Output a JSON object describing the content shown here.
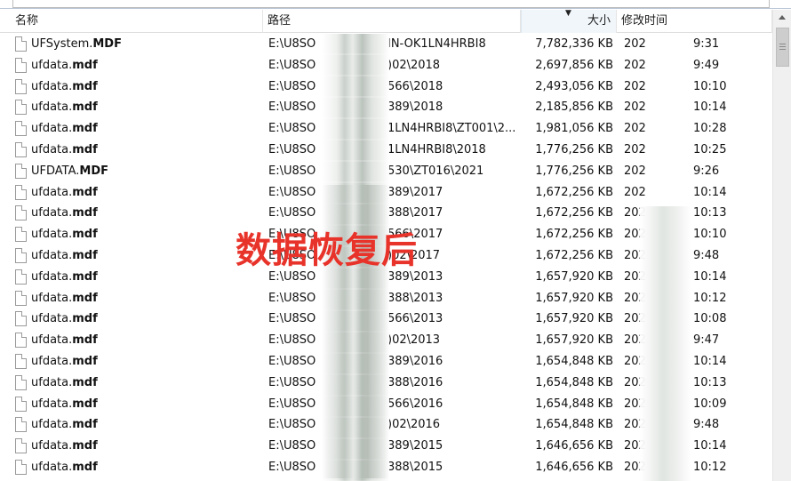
{
  "header": {
    "name": "名称",
    "path": "路径",
    "size": "大小",
    "date": "修改时间"
  },
  "watermark": "数据恢复后",
  "rows": [
    {
      "name_prefix": "UFSystem.",
      "name_ext": "MDF",
      "path_start": "E:\\U8SO",
      "path_end": "IN-OK1LN4HRBI8",
      "size": "7,782,336 KB",
      "date_start": "202",
      "time": "9:31"
    },
    {
      "name_prefix": "ufdata.",
      "name_ext": "mdf",
      "path_start": "E:\\U8SO",
      "path_end": ")02\\2018",
      "size": "2,697,856 KB",
      "date_start": "202",
      "time": "9:49"
    },
    {
      "name_prefix": "ufdata.",
      "name_ext": "mdf",
      "path_start": "E:\\U8SO",
      "path_end": "566\\2018",
      "size": "2,493,056 KB",
      "date_start": "202",
      "time": "10:10"
    },
    {
      "name_prefix": "ufdata.",
      "name_ext": "mdf",
      "path_start": "E:\\U8SO",
      "path_end": "389\\2018",
      "size": "2,185,856 KB",
      "date_start": "202",
      "time": "10:14"
    },
    {
      "name_prefix": "ufdata.",
      "name_ext": "mdf",
      "path_start": "E:\\U8SO",
      "path_end": "1LN4HRBI8\\ZT001\\2...",
      "size": "1,981,056 KB",
      "date_start": "202",
      "time": "10:28"
    },
    {
      "name_prefix": "ufdata.",
      "name_ext": "mdf",
      "path_start": "E:\\U8SO",
      "path_end": "1LN4HRBI8\\2018",
      "size": "1,776,256 KB",
      "date_start": "202",
      "time": "10:25"
    },
    {
      "name_prefix": "UFDATA.",
      "name_ext": "MDF",
      "path_start": "E:\\U8SO",
      "path_end": "530\\ZT016\\2021",
      "size": "1,776,256 KB",
      "date_start": "202",
      "time": "9:26"
    },
    {
      "name_prefix": "ufdata.",
      "name_ext": "mdf",
      "path_start": "E:\\U8SO",
      "path_end": "389\\2017",
      "size": "1,672,256 KB",
      "date_start": "202",
      "time": "10:14"
    },
    {
      "name_prefix": "ufdata.",
      "name_ext": "mdf",
      "path_start": "E:\\U8SO",
      "path_end": "388\\2017",
      "size": "1,672,256 KB",
      "date_start": "202",
      "time": "10:13"
    },
    {
      "name_prefix": "ufdata.",
      "name_ext": "mdf",
      "path_start": "E:\\U8SO",
      "path_end": "566\\2017",
      "size": "1,672,256 KB",
      "date_start": "202",
      "time": "10:10"
    },
    {
      "name_prefix": "ufdata.",
      "name_ext": "mdf",
      "path_start": "E:\\U8SO",
      "path_end": ")02\\2017",
      "size": "1,672,256 KB",
      "date_start": "202",
      "time": "9:48"
    },
    {
      "name_prefix": "ufdata.",
      "name_ext": "mdf",
      "path_start": "E:\\U8SO",
      "path_end": "389\\2013",
      "size": "1,657,920 KB",
      "date_start": "202",
      "time": "10:14"
    },
    {
      "name_prefix": "ufdata.",
      "name_ext": "mdf",
      "path_start": "E:\\U8SO",
      "path_end": "388\\2013",
      "size": "1,657,920 KB",
      "date_start": "202",
      "time": "10:12"
    },
    {
      "name_prefix": "ufdata.",
      "name_ext": "mdf",
      "path_start": "E:\\U8SO",
      "path_end": "566\\2013",
      "size": "1,657,920 KB",
      "date_start": "202",
      "time": "10:08"
    },
    {
      "name_prefix": "ufdata.",
      "name_ext": "mdf",
      "path_start": "E:\\U8SO",
      "path_end": ")02\\2013",
      "size": "1,657,920 KB",
      "date_start": "202",
      "time": "9:47"
    },
    {
      "name_prefix": "ufdata.",
      "name_ext": "mdf",
      "path_start": "E:\\U8SO",
      "path_end": "389\\2016",
      "size": "1,654,848 KB",
      "date_start": "202",
      "time": "10:14"
    },
    {
      "name_prefix": "ufdata.",
      "name_ext": "mdf",
      "path_start": "E:\\U8SO",
      "path_end": "388\\2016",
      "size": "1,654,848 KB",
      "date_start": "202",
      "time": "10:13"
    },
    {
      "name_prefix": "ufdata.",
      "name_ext": "mdf",
      "path_start": "E:\\U8SO",
      "path_end": "566\\2016",
      "size": "1,654,848 KB",
      "date_start": "202",
      "time": "10:09"
    },
    {
      "name_prefix": "ufdata.",
      "name_ext": "mdf",
      "path_start": "E:\\U8SO",
      "path_end": ")02\\2016",
      "size": "1,654,848 KB",
      "date_start": "202",
      "time": "9:48"
    },
    {
      "name_prefix": "ufdata.",
      "name_ext": "mdf",
      "path_start": "E:\\U8SO",
      "path_end": "389\\2015",
      "size": "1,646,656 KB",
      "date_start": "202",
      "time": "10:14"
    },
    {
      "name_prefix": "ufdata.",
      "name_ext": "mdf",
      "path_start": "E:\\U8SO",
      "path_end": "388\\2015",
      "size": "1,646,656 KB",
      "date_start": "202",
      "time": "10:12"
    }
  ],
  "icons": {
    "file": "document-icon",
    "sort": "sort-descending-icon",
    "scroll_up": "scroll-up-arrow-icon"
  },
  "colors": {
    "watermark": "#e8332a",
    "sorted_header_bg": "#f1f6fb",
    "scrollbar_bg": "#f0f0f0"
  }
}
